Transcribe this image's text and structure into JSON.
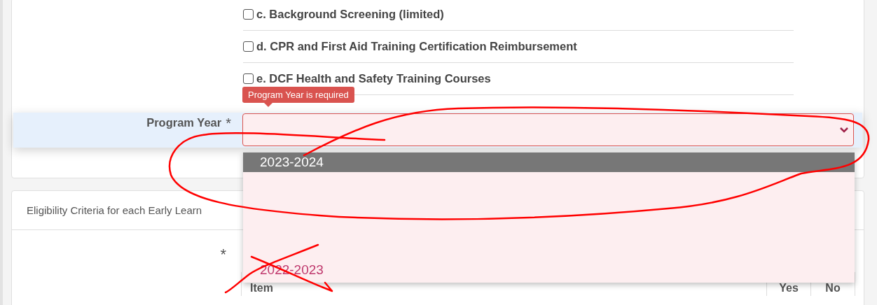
{
  "checklist": [
    {
      "label": "c. Background Screening (limited)",
      "checked": false
    },
    {
      "label": "d. CPR and First Aid Training Certification Reimbursement",
      "checked": false
    },
    {
      "label": "e. DCF Health and Safety Training Courses",
      "checked": false
    }
  ],
  "program_year": {
    "label": "Program Year",
    "required_mark": "*",
    "error_tooltip": "Program Year is required",
    "invalid": true,
    "dropdown": {
      "open": true,
      "options": [
        {
          "label": "2023-2024",
          "selected": true
        },
        {
          "label": "2022-2023",
          "selected": false
        }
      ]
    }
  },
  "eligibility": {
    "header": "Eligibility Criteria for each Early Learn",
    "required_mark": "*",
    "table": {
      "columns": [
        "Item",
        "Yes",
        "No"
      ]
    }
  }
}
